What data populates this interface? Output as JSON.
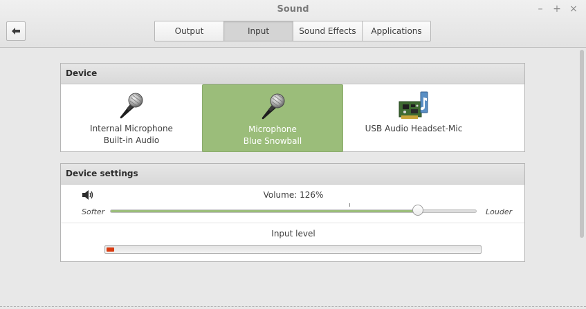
{
  "window": {
    "title": "Sound",
    "minimize_symbol": "–",
    "maximize_symbol": "+",
    "close_symbol": "×"
  },
  "toolbar": {
    "back_icon": "arrow-left-icon",
    "tabs": [
      {
        "label": "Output",
        "active": false
      },
      {
        "label": "Input",
        "active": true
      },
      {
        "label": "Sound Effects",
        "active": false
      },
      {
        "label": "Applications",
        "active": false
      }
    ]
  },
  "device_section": {
    "title": "Device",
    "devices": [
      {
        "name": "Internal Microphone",
        "detail": "Built-in Audio",
        "icon": "microphone-icon",
        "selected": false
      },
      {
        "name": "Microphone",
        "detail": "Blue Snowball",
        "icon": "microphone-icon",
        "selected": true
      },
      {
        "name": "USB Audio Headset-Mic",
        "detail": "",
        "icon": "sound-card-icon",
        "selected": false
      }
    ]
  },
  "settings_section": {
    "title": "Device settings",
    "volume_label": "Volume: 126%",
    "volume_percent": 126,
    "volume_max_percent": 150,
    "softer_label": "Softer",
    "louder_label": "Louder",
    "input_level_label": "Input level",
    "input_level_fraction": 0.02
  },
  "colors": {
    "accent": "#9bbd7a",
    "level": "#d93b10"
  }
}
